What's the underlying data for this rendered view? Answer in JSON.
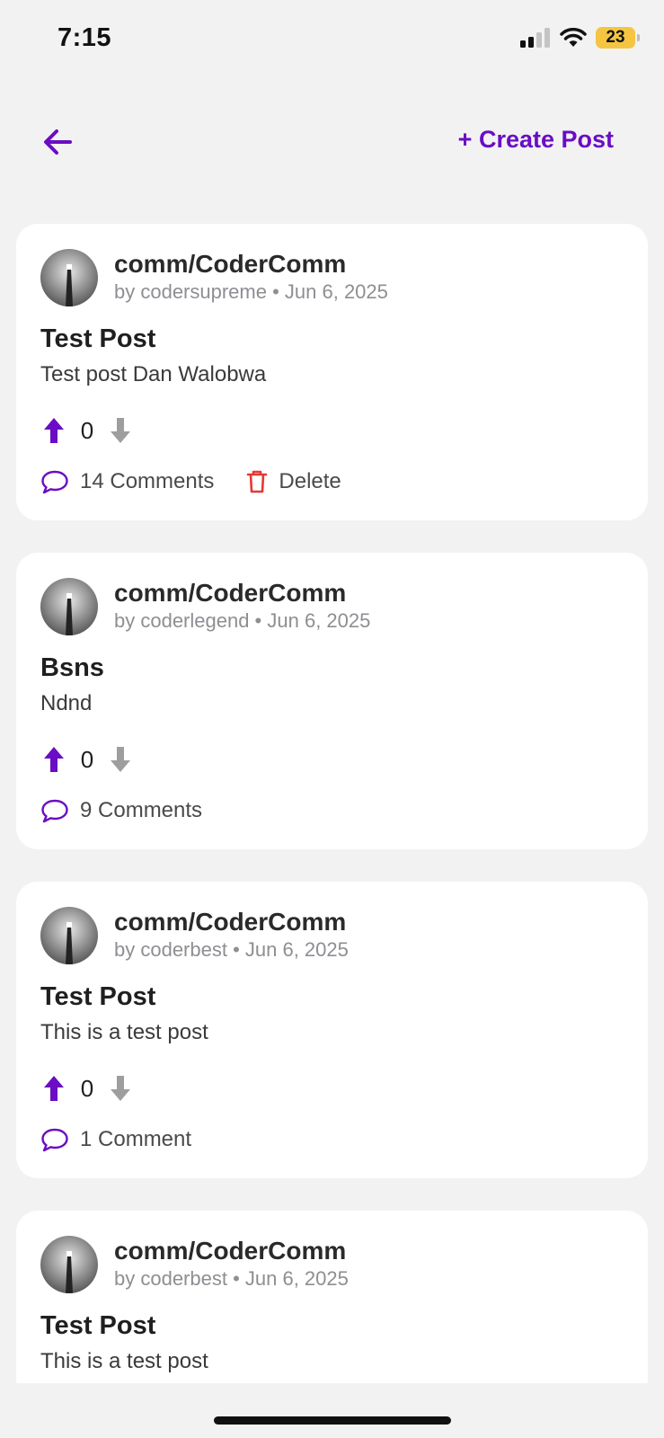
{
  "status_bar": {
    "time": "7:15",
    "battery": "23"
  },
  "nav": {
    "create_post_label": "+ Create Post"
  },
  "colors": {
    "accent": "#6a0dc4",
    "delete": "#e53935",
    "muted": "#8e8e93",
    "background": "#f2f2f3"
  },
  "posts": [
    {
      "community": "comm/CoderComm",
      "meta": "by codersupreme • Jun 6, 2025",
      "title": "Test Post",
      "body": "Test post Dan Walobwa",
      "votes": "0",
      "comments": "14 Comments",
      "delete_label": "Delete"
    },
    {
      "community": "comm/CoderComm",
      "meta": "by coderlegend • Jun 6, 2025",
      "title": "Bsns",
      "body": "Ndnd",
      "votes": "0",
      "comments": "9 Comments"
    },
    {
      "community": "comm/CoderComm",
      "meta": "by coderbest • Jun 6, 2025",
      "title": "Test Post",
      "body": "This is a test post",
      "votes": "0",
      "comments": "1 Comment"
    },
    {
      "community": "comm/CoderComm",
      "meta": "by coderbest • Jun 6, 2025",
      "title": "Test Post",
      "body": "This is a test post"
    }
  ],
  "icons": {
    "back": "arrow-left-icon",
    "upvote": "arrow-up-icon",
    "downvote": "arrow-down-icon",
    "comment": "comment-bubble-icon",
    "delete": "trash-icon"
  }
}
